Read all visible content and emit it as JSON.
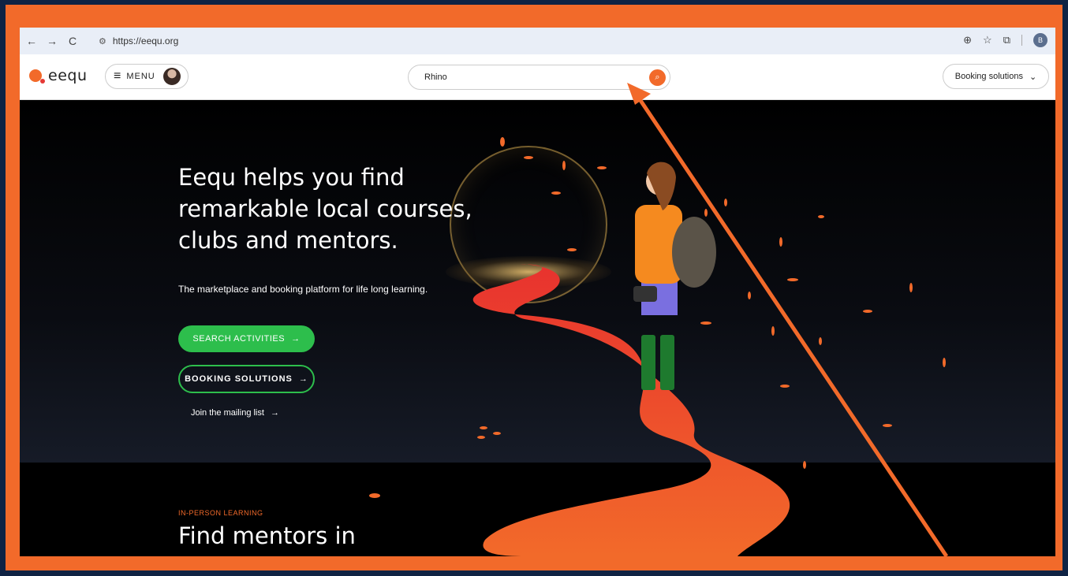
{
  "colors": {
    "frame": "#f26a2a",
    "accent_green": "#2dbe4c",
    "background": "#0f2344"
  },
  "browser": {
    "url": "https://eequ.org",
    "nav": {
      "back": "←",
      "forward": "→",
      "reload": "C"
    },
    "profile_initial": "B"
  },
  "header": {
    "logo_text": "eequ",
    "menu_label": "MENU",
    "search_value": "Rhino",
    "booking_label": "Booking solutions"
  },
  "hero": {
    "title_lines": [
      "Eequ helps you find",
      "remarkable local courses,",
      "clubs and mentors."
    ],
    "subtitle": "The marketplace and booking platform for life long learning.",
    "search_button": "SEARCH ACTIVITIES",
    "booking_button": "BOOKING SOLUTIONS",
    "mailing_link": "Join the mailing list"
  },
  "section": {
    "eyebrow": "IN-PERSON LEARNING",
    "title": "Find mentors in"
  },
  "icons": {
    "arrow": "→",
    "chevron": "⌄",
    "zoom": "🔍",
    "star": "☆",
    "extension": "⧉"
  }
}
